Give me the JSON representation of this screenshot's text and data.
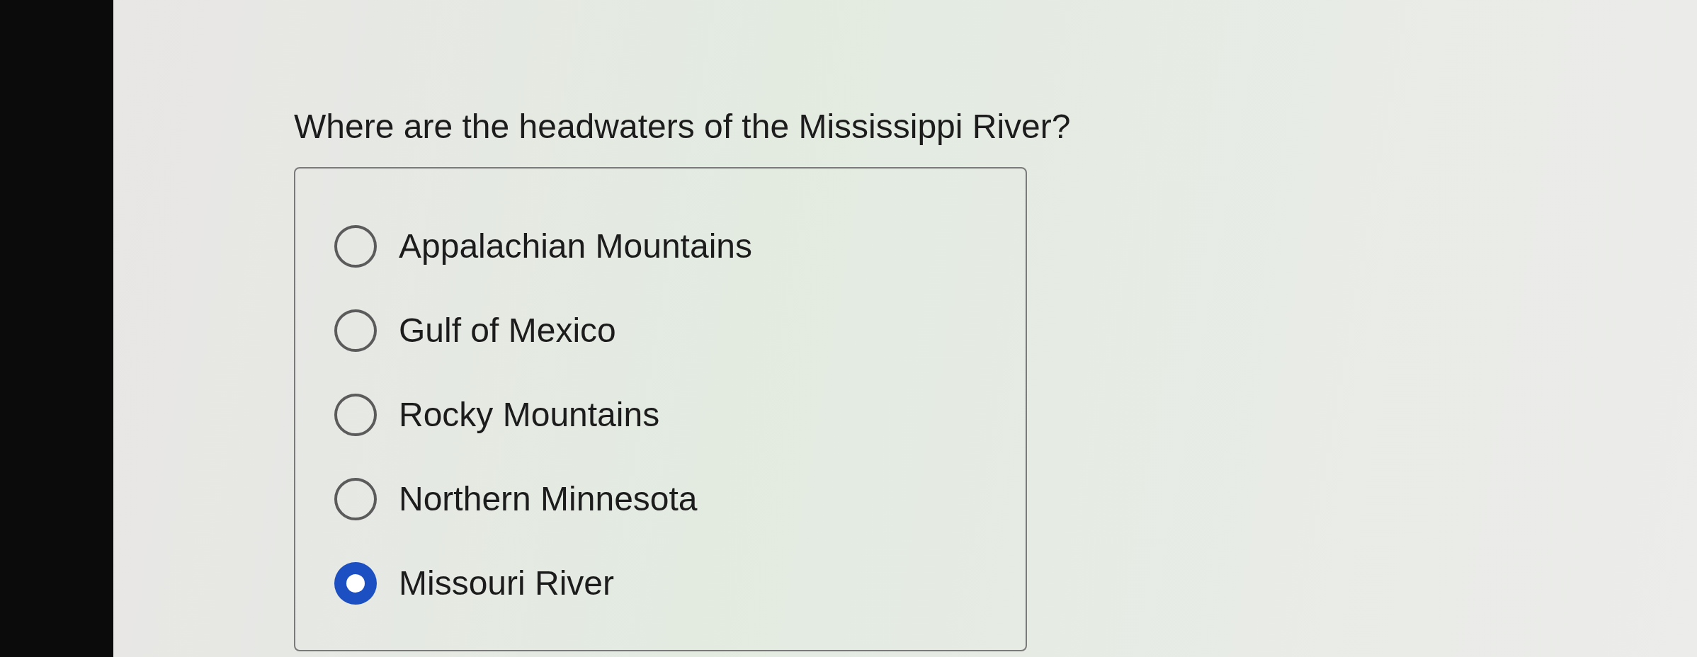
{
  "question": "Where are the headwaters of the Mississippi River?",
  "options": [
    {
      "label": "Appalachian Mountains",
      "selected": false
    },
    {
      "label": "Gulf of Mexico",
      "selected": false
    },
    {
      "label": "Rocky Mountains",
      "selected": false
    },
    {
      "label": "Northern Minnesota",
      "selected": false
    },
    {
      "label": "Missouri River",
      "selected": true
    }
  ]
}
